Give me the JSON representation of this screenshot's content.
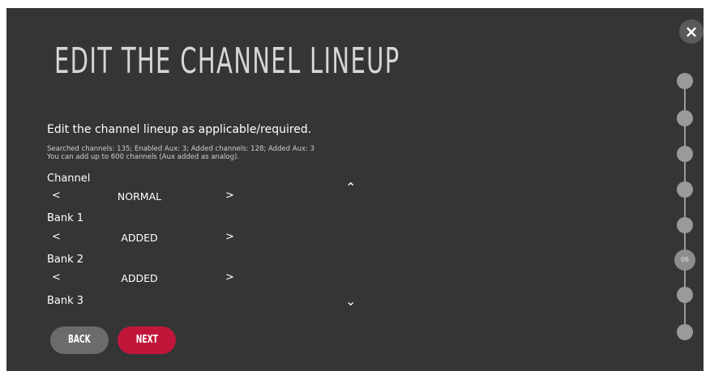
{
  "title": "EDIT THE CHANNEL LINEUP",
  "subtitle": "Edit the channel lineup as applicable/required.",
  "info_line1": "Searched channels: 135; Enabled Aux: 3; Added channels: 128; Added Aux: 3",
  "info_line2": "You can add up to 600 channels (Aux added as analog).",
  "rows": [
    {
      "label": "Channel",
      "value": "NORMAL"
    },
    {
      "label": "Bank 1",
      "value": "ADDED"
    },
    {
      "label": "Bank 2",
      "value": "ADDED"
    },
    {
      "label": "Bank 3",
      "value": ""
    }
  ],
  "arrows": {
    "left": "<",
    "right": ">",
    "up": "⌃",
    "down": "⌄"
  },
  "close_glyph": "×",
  "buttons": {
    "back": "BACK",
    "next": "NEXT"
  },
  "steps": {
    "current_label": "06",
    "total": 8,
    "current_index": 5
  },
  "colors": {
    "background": "#353535",
    "accent": "#c1163a",
    "back_button": "#6b6b6b"
  },
  "icons": [
    "close-icon",
    "chevron-left-icon",
    "chevron-right-icon",
    "chevron-up-icon",
    "chevron-down-icon"
  ]
}
